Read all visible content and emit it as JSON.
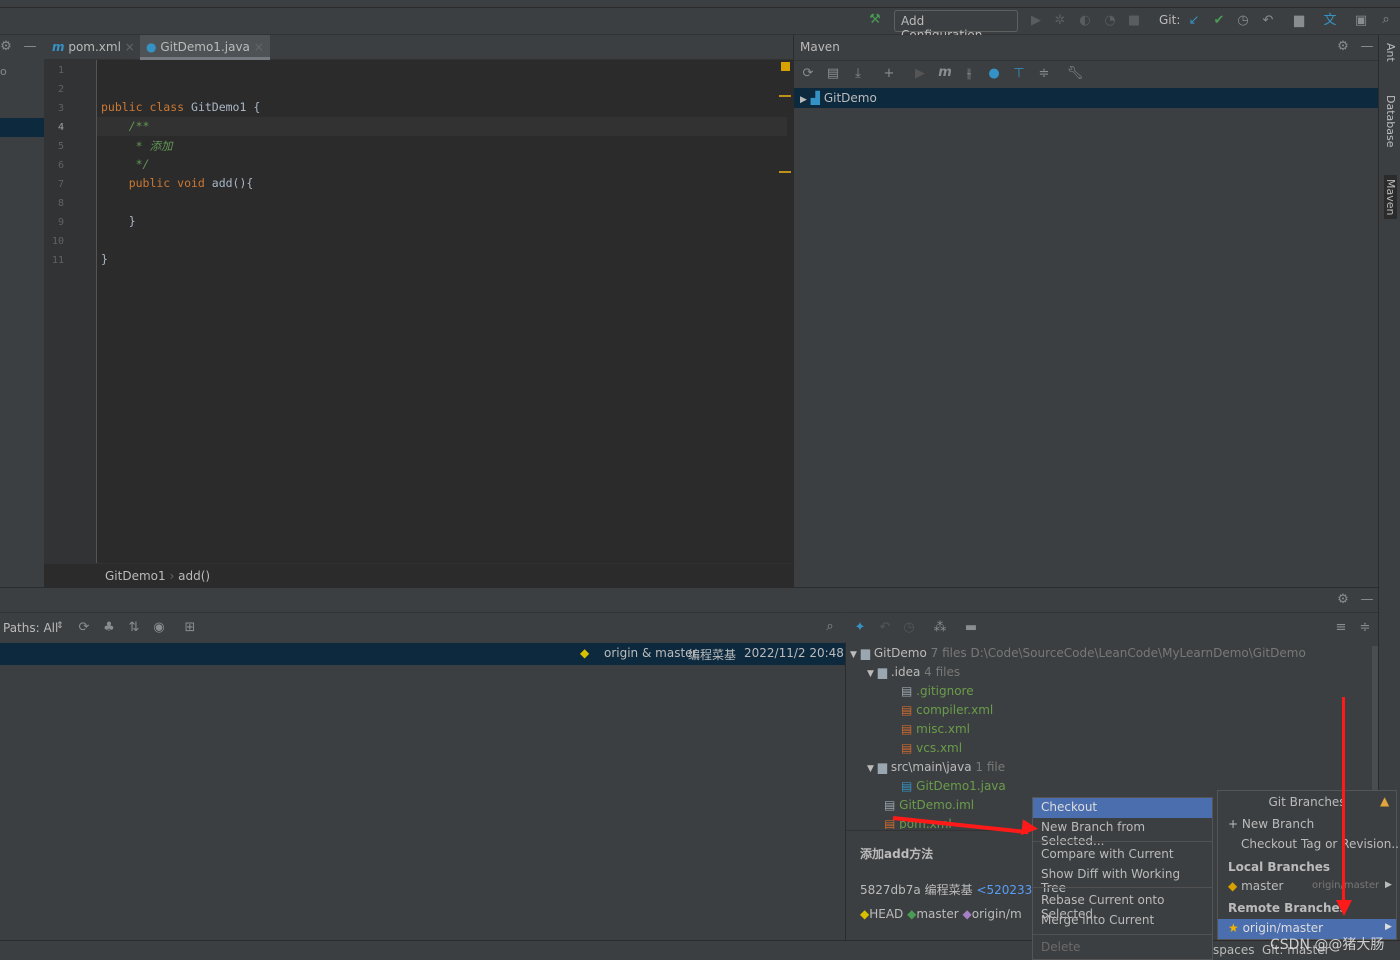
{
  "toolbar": {
    "add_configuration": "Add Configuration...",
    "git_label": "Git:"
  },
  "tabs": [
    {
      "label": "pom.xml",
      "icon": "maven-m-icon"
    },
    {
      "label": "GitDemo1.java",
      "icon": "java-class-icon"
    }
  ],
  "left_panel": {
    "partial_label": "o"
  },
  "editor": {
    "line_numbers": [
      "1",
      "2",
      "3",
      "4",
      "5",
      "6",
      "7",
      "8",
      "9",
      "10",
      "11"
    ],
    "current_line": "4",
    "lines": [
      {
        "kw": "",
        "text": ""
      },
      {
        "kw": "public class ",
        "text": "GitDemo1 {"
      },
      {
        "kw": "",
        "text": "    /**",
        "comment": true
      },
      {
        "kw": "",
        "text": "     * 添加",
        "comment": true
      },
      {
        "kw": "",
        "text": "     */",
        "comment": true
      },
      {
        "kw": "    public void ",
        "text": "add(){"
      },
      {
        "kw": "",
        "text": ""
      },
      {
        "kw": "",
        "text": "    }"
      },
      {
        "kw": "",
        "text": ""
      },
      {
        "kw": "",
        "text": "}"
      },
      {
        "kw": "",
        "text": ""
      }
    ],
    "breadcrumb": [
      "GitDemo1",
      "add()"
    ]
  },
  "maven": {
    "title": "Maven",
    "project": "GitDemo"
  },
  "right_stripe": [
    "Ant",
    "Database",
    "Maven"
  ],
  "git_log": {
    "paths_filter": "Paths: All",
    "selected_commit": {
      "refs": "origin & master",
      "author": "编程菜基",
      "date": "2022/11/2 20:48"
    }
  },
  "changes_tree": {
    "root": {
      "name": "GitDemo",
      "count": "7 files",
      "path": "D:\\Code\\SourceCode\\LeanCode\\MyLearnDemo\\GitDemo"
    },
    "items": [
      {
        "name": ".idea",
        "count": "4 files",
        "type": "folder"
      },
      {
        "name": ".gitignore",
        "type": "file"
      },
      {
        "name": "compiler.xml",
        "type": "file"
      },
      {
        "name": "misc.xml",
        "type": "file"
      },
      {
        "name": "vcs.xml",
        "type": "file"
      },
      {
        "name": "src\\main\\java",
        "count": "1 file",
        "type": "folder"
      },
      {
        "name": "GitDemo1.java",
        "type": "file"
      },
      {
        "name": "GitDemo.iml",
        "type": "file"
      },
      {
        "name": "pom.xml",
        "type": "file"
      }
    ]
  },
  "commit_details": {
    "message": "添加add方法",
    "hash": "5827db7a",
    "author": "编程菜基",
    "email": "<5202330+",
    "refs": [
      "HEAD",
      "master",
      "origin/m"
    ]
  },
  "context_menu": {
    "items": [
      "Checkout",
      "New Branch from Selected...",
      "Compare with Current",
      "Show Diff with Working Tree",
      "Rebase Current onto Selected",
      "Merge into Current",
      "Delete"
    ],
    "selected": "Checkout"
  },
  "git_branches": {
    "title": "Git Branches",
    "new_branch": "New Branch",
    "checkout_tag": "Checkout Tag or Revision...",
    "local_header": "Local Branches",
    "local": [
      {
        "name": "master",
        "tracking": "origin/master"
      }
    ],
    "remote_header": "Remote Branches",
    "remote": [
      {
        "name": "origin/master"
      }
    ]
  },
  "status_bar": {
    "spaces": "spaces",
    "git_branch": "Git: master"
  },
  "watermark": "CSDN @@猪大肠",
  "colors": {
    "selection": "#4b6eaf",
    "annotation_arrow": "#ff1a1a",
    "added_file": "#6a9c4a"
  }
}
